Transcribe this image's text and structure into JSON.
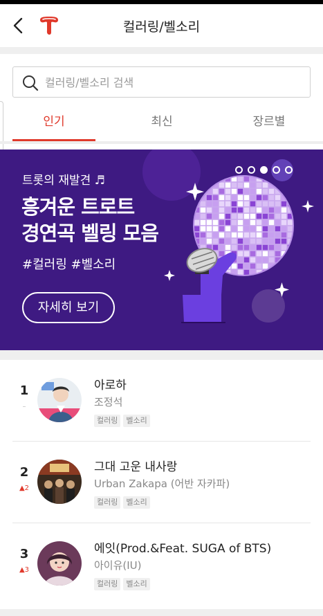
{
  "header": {
    "title": "컬러링/벨소리",
    "back_icon": "chevron-left-icon",
    "logo_icon": "t-logo-icon",
    "brand_color": "#e0392b"
  },
  "search": {
    "placeholder": "컬러링/벨소리 검색",
    "value": ""
  },
  "tabs": [
    {
      "label": "인기",
      "active": true
    },
    {
      "label": "최신",
      "active": false
    },
    {
      "label": "장르별",
      "active": false
    }
  ],
  "banner": {
    "subtitle": "트롯의 재발견 ♬",
    "title_line1": "흥겨운 트로트",
    "title_line2": "경연곡 벨링 모음",
    "tags": "#컬러링 #벨소리",
    "button_label": "자세히 보기",
    "background_color": "#3e1a82",
    "slide_count": 5,
    "active_slide": 2
  },
  "chart": {
    "items": [
      {
        "rank": "1",
        "change": "–",
        "change_type": "same",
        "title": "아로하",
        "artist": "조정석",
        "badges": [
          "컬러링",
          "벨소리"
        ]
      },
      {
        "rank": "2",
        "change": "▲2",
        "change_type": "up",
        "title": "그대 고운 내사랑",
        "artist": "Urban Zakapa (어반 자카파)",
        "badges": [
          "컬러링",
          "벨소리"
        ]
      },
      {
        "rank": "3",
        "change": "▲3",
        "change_type": "up",
        "title": "에잇(Prod.&Feat. SUGA of BTS)",
        "artist": "아이유(IU)",
        "badges": [
          "컬러링",
          "벨소리"
        ]
      }
    ]
  }
}
